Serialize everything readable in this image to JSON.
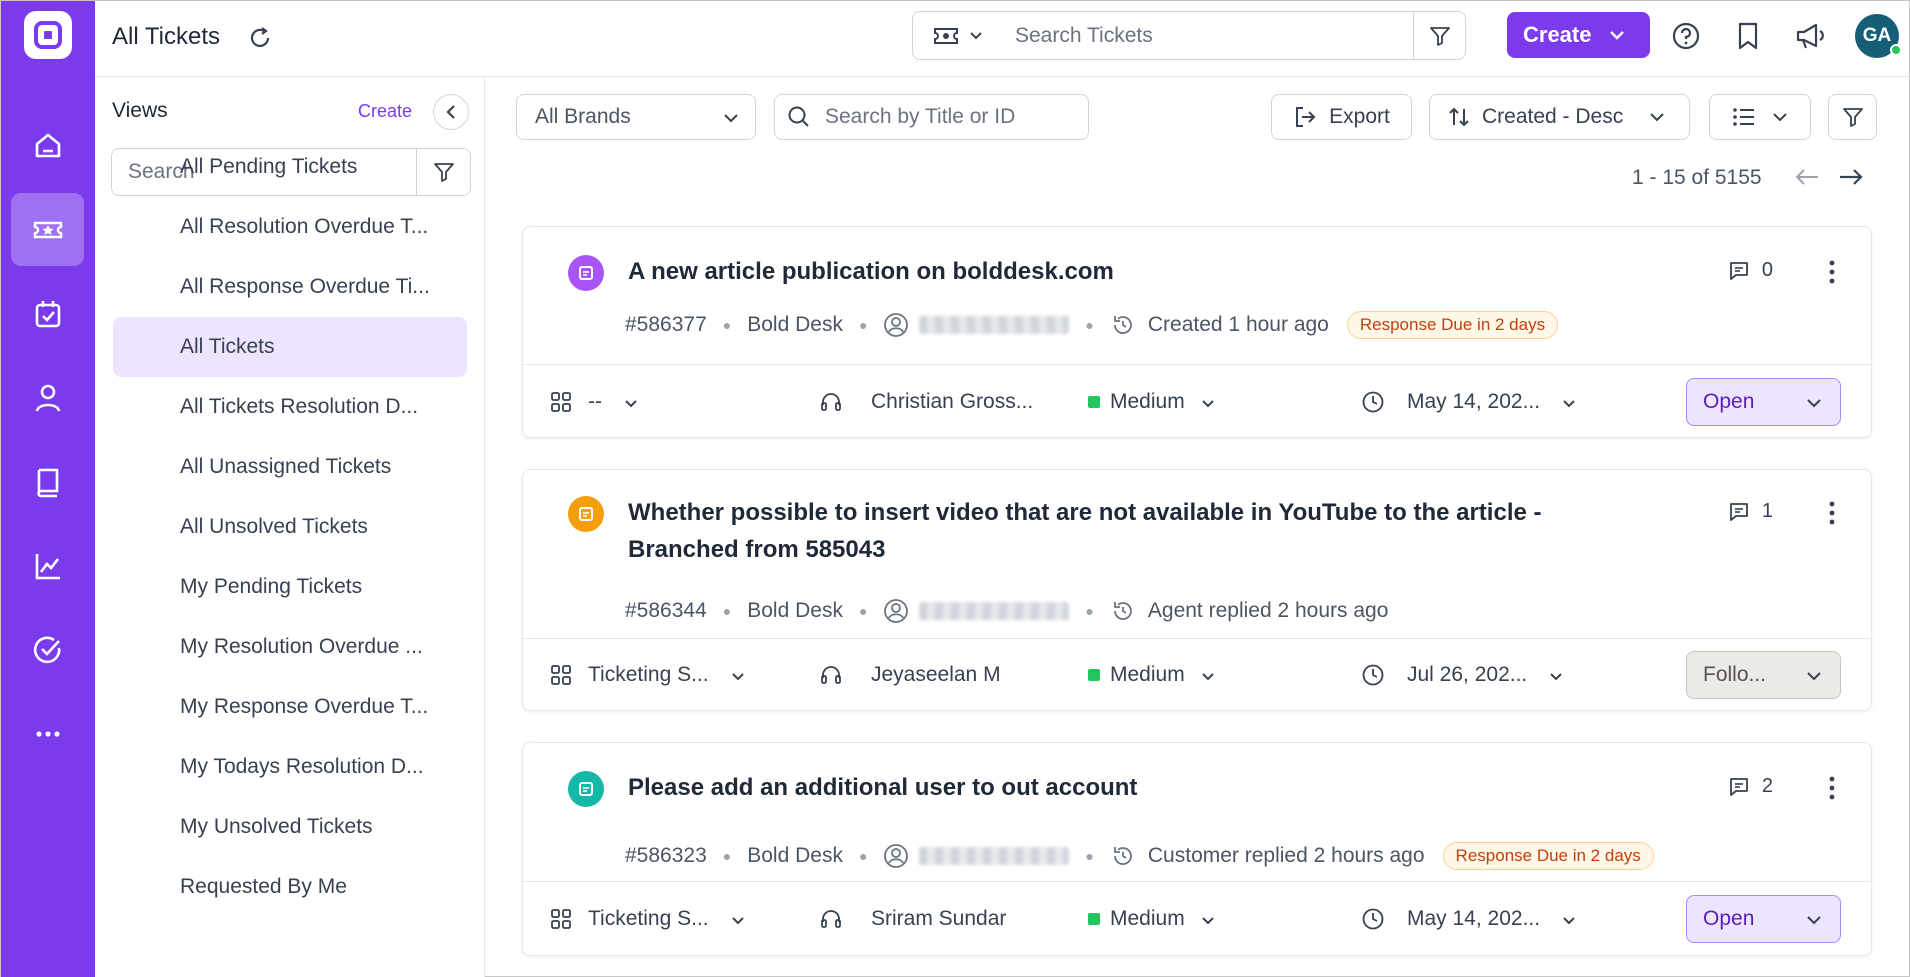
{
  "header": {
    "title": "All Tickets",
    "search_placeholder": "Search Tickets",
    "create_label": "Create",
    "avatar_initials": "GA"
  },
  "colors": {
    "brand": "#7c3aed",
    "priority_medium": "#22c55e",
    "badge_text": "#c2410c"
  },
  "rail": {
    "items": [
      "home-icon",
      "tickets-icon",
      "calendar-check-icon",
      "contacts-icon",
      "knowledge-base-icon",
      "reports-icon",
      "tasks-icon",
      "more-icon"
    ],
    "active": "tickets-icon"
  },
  "views": {
    "title": "Views",
    "create_label": "Create",
    "search_placeholder": "Search",
    "items": [
      {
        "label": "All Pending Tickets"
      },
      {
        "label": "All Resolution Overdue T..."
      },
      {
        "label": "All Response Overdue Ti..."
      },
      {
        "label": "All Tickets",
        "active": true
      },
      {
        "label": "All Tickets Resolution D..."
      },
      {
        "label": "All Unassigned Tickets"
      },
      {
        "label": "All Unsolved Tickets"
      },
      {
        "label": "My Pending Tickets"
      },
      {
        "label": "My Resolution Overdue ..."
      },
      {
        "label": "My Response Overdue T..."
      },
      {
        "label": "My Todays Resolution D..."
      },
      {
        "label": "My Unsolved Tickets"
      },
      {
        "label": "Requested By Me"
      }
    ]
  },
  "toolbar": {
    "brands_value": "All Brands",
    "search_placeholder": "Search by Title or ID",
    "export_label": "Export",
    "sort_label": "Created - Desc",
    "pager_text": "1 - 15 of 5155"
  },
  "tickets": [
    {
      "title_line1": "A new article publication on bolddesk.com",
      "title_line2": "",
      "id": "#586377",
      "brand": "Bold Desk",
      "activity": "Created 1 hour ago",
      "badge": "Response Due in 2 days",
      "comments": "0",
      "category": "--",
      "agent": "Christian Gross...",
      "priority": "Medium",
      "due": "May 14, 202...",
      "status": "Open",
      "type_color": "#a855f7"
    },
    {
      "title_line1": "Whether possible to insert video that are not available in YouTube to the article -",
      "title_line2": "Branched from 585043",
      "id": "#586344",
      "brand": "Bold Desk",
      "activity": "Agent replied 2 hours ago",
      "badge": "",
      "comments": "1",
      "category": "Ticketing S...",
      "agent": "Jeyaseelan M",
      "priority": "Medium",
      "due": "Jul 26, 202...",
      "status": "Follo...",
      "type_color": "#f59e0b"
    },
    {
      "title_line1": "Please add an additional user to out account",
      "title_line2": "",
      "id": "#586323",
      "brand": "Bold Desk",
      "activity": "Customer replied 2 hours ago",
      "badge": "Response Due in 2 days",
      "comments": "2",
      "category": "Ticketing S...",
      "agent": "Sriram Sundar",
      "priority": "Medium",
      "due": "May 14, 202...",
      "status": "Open",
      "type_color": "#14b8a6"
    }
  ]
}
